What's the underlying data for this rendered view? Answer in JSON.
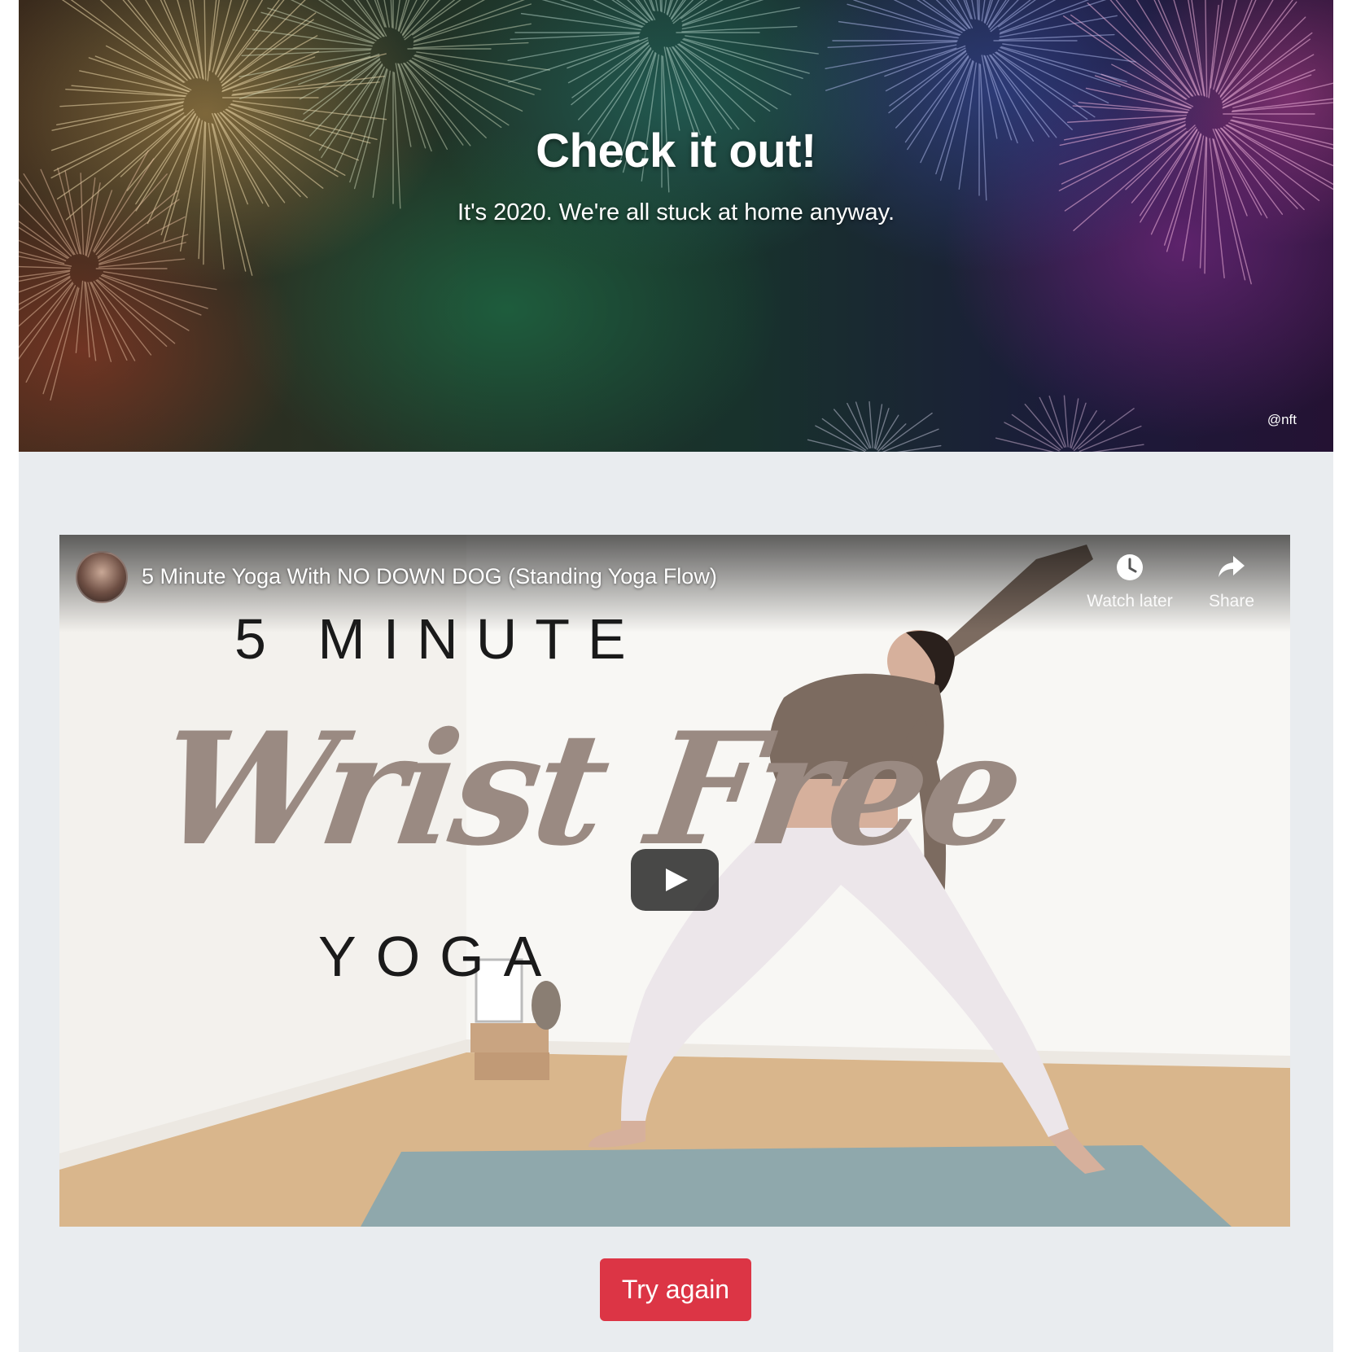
{
  "hero": {
    "title": "Check it out!",
    "subtitle": "It's 2020. We're all stuck at home anyway.",
    "credit": "@nft"
  },
  "video": {
    "title": "5 Minute Yoga With NO DOWN DOG (Standing Yoga Flow)",
    "actions": {
      "watch_later": "Watch later",
      "share": "Share"
    },
    "thumbnail": {
      "line1": "5 MINUTE",
      "script": "Wrist Free",
      "line3": "YOGA"
    },
    "icons": {
      "watch_later": "clock-icon",
      "share": "share-arrow-icon",
      "play": "play-icon"
    }
  },
  "actions": {
    "try_again": "Try again"
  },
  "colors": {
    "page_bg": "#e9ecef",
    "danger": "#dc3545",
    "mat": "#8fa8ac",
    "floor": "#d9b68c",
    "script_text": "#9a8a82"
  }
}
